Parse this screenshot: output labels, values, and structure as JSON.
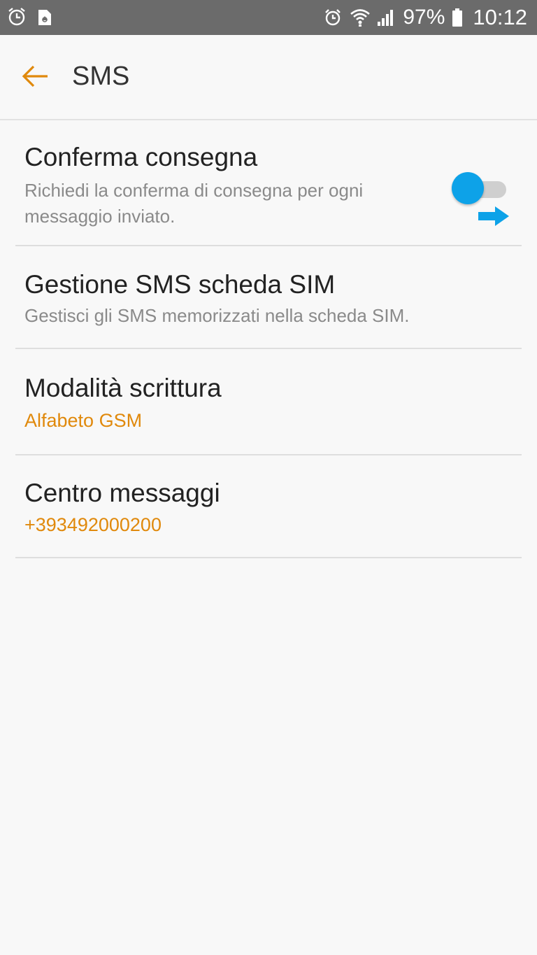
{
  "status_bar": {
    "left_icons": [
      "alarm-icon",
      "recycle-notification-icon"
    ],
    "right_icons": [
      "alarm-icon",
      "wifi-icon",
      "signal-icon",
      "battery-icon"
    ],
    "battery_percent": "97%",
    "time": "10:12"
  },
  "app_bar": {
    "back_icon": "back-arrow-icon",
    "title": "SMS"
  },
  "settings": {
    "items": [
      {
        "title": "Conferma consegna",
        "subtitle": "Richiedi la conferma di consegna per ogni messaggio inviato.",
        "toggle": {
          "state": "off"
        },
        "indicator_icon": "right-arrow-icon"
      },
      {
        "title": "Gestione SMS scheda SIM",
        "subtitle": "Gestisci gli SMS memorizzati nella scheda SIM."
      },
      {
        "title": "Modalità scrittura",
        "value": "Alfabeto GSM"
      },
      {
        "title": "Centro messaggi",
        "value": "+393492000200"
      }
    ]
  },
  "colors": {
    "status_bar_bg": "#6b6b6b",
    "background": "#f8f8f8",
    "accent_orange": "#e0890c",
    "toggle_blue": "#0da2e8",
    "title_text": "#222222",
    "subtitle_text": "#8a8a8a",
    "divider": "#dedede"
  }
}
